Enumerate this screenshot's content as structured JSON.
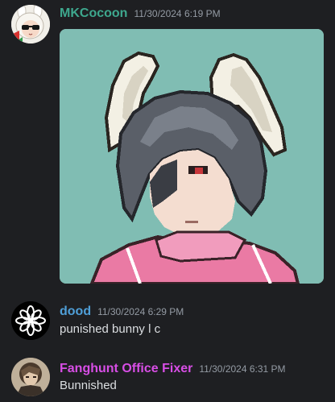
{
  "messages": [
    {
      "username": "MKCocoon",
      "timestamp": "11/30/2024 6:19 PM",
      "name_color": "#3ea88e",
      "avatar": "anime-avatar-with-bunny-ears-and-sunglasses",
      "attachment": "pixel-art-bunny-girl-image"
    },
    {
      "username": "dood",
      "timestamp": "11/30/2024 6:29 PM",
      "name_color": "#4f9fd8",
      "avatar": "white-flower-logo-avatar",
      "text": "punished bunny l c"
    },
    {
      "username": "Fanghunt Office Fixer",
      "timestamp": "11/30/2024 6:31 PM",
      "name_color": "#d84ee6",
      "avatar": "sepia-portrait-avatar",
      "text": "Bunnished"
    }
  ]
}
